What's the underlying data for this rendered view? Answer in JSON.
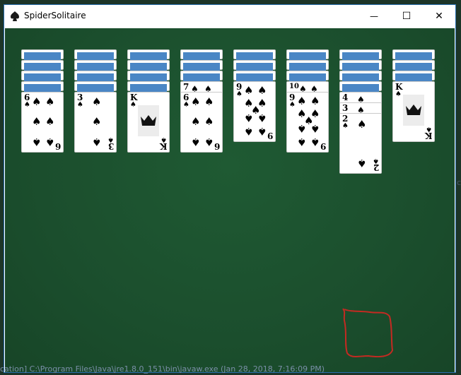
{
  "window": {
    "title": "SpiderSolitaire",
    "minimize_glyph": "—",
    "maximize_glyph": "☐",
    "close_glyph": "✕"
  },
  "status_text": "cation] C:\\Program Files\\Java\\jre1.8.0_151\\bin\\javaw.exe (Jan 28, 2018, 7:16:09 PM)",
  "colors": {
    "felt": "#1b4e2d",
    "card_back": "#4a86c5",
    "annotation": "#c42a22"
  },
  "suit_symbol": "♠",
  "icons": [
    "app-icon",
    "minimize-icon",
    "maximize-icon",
    "close-icon",
    "crown-icon"
  ],
  "columns": [
    {
      "face_down": 4,
      "cards": [
        "6"
      ],
      "top_card": {
        "rank": "6",
        "suit": "♠"
      }
    },
    {
      "face_down": 4,
      "cards": [
        "3"
      ],
      "top_card": {
        "rank": "3",
        "suit": "♠"
      }
    },
    {
      "face_down": 4,
      "cards": [
        "K"
      ],
      "top_card": {
        "rank": "K",
        "suit": "♠"
      }
    },
    {
      "face_down": 3,
      "cards": [
        "7",
        "6"
      ],
      "top_card": {
        "rank": "6",
        "suit": "♠"
      }
    },
    {
      "face_down": 3,
      "cards": [
        "9"
      ],
      "top_card": {
        "rank": "9",
        "suit": "♠"
      }
    },
    {
      "face_down": 3,
      "cards": [
        "10",
        "9"
      ],
      "top_card": {
        "rank": "9",
        "suit": "♠"
      }
    },
    {
      "face_down": 4,
      "cards": [
        "4",
        "3",
        "2"
      ],
      "top_card": {
        "rank": "2",
        "suit": "♠"
      }
    },
    {
      "face_down": 4,
      "cards": [
        "K"
      ],
      "top_card": {
        "rank": "K",
        "suit": "♠"
      }
    }
  ]
}
